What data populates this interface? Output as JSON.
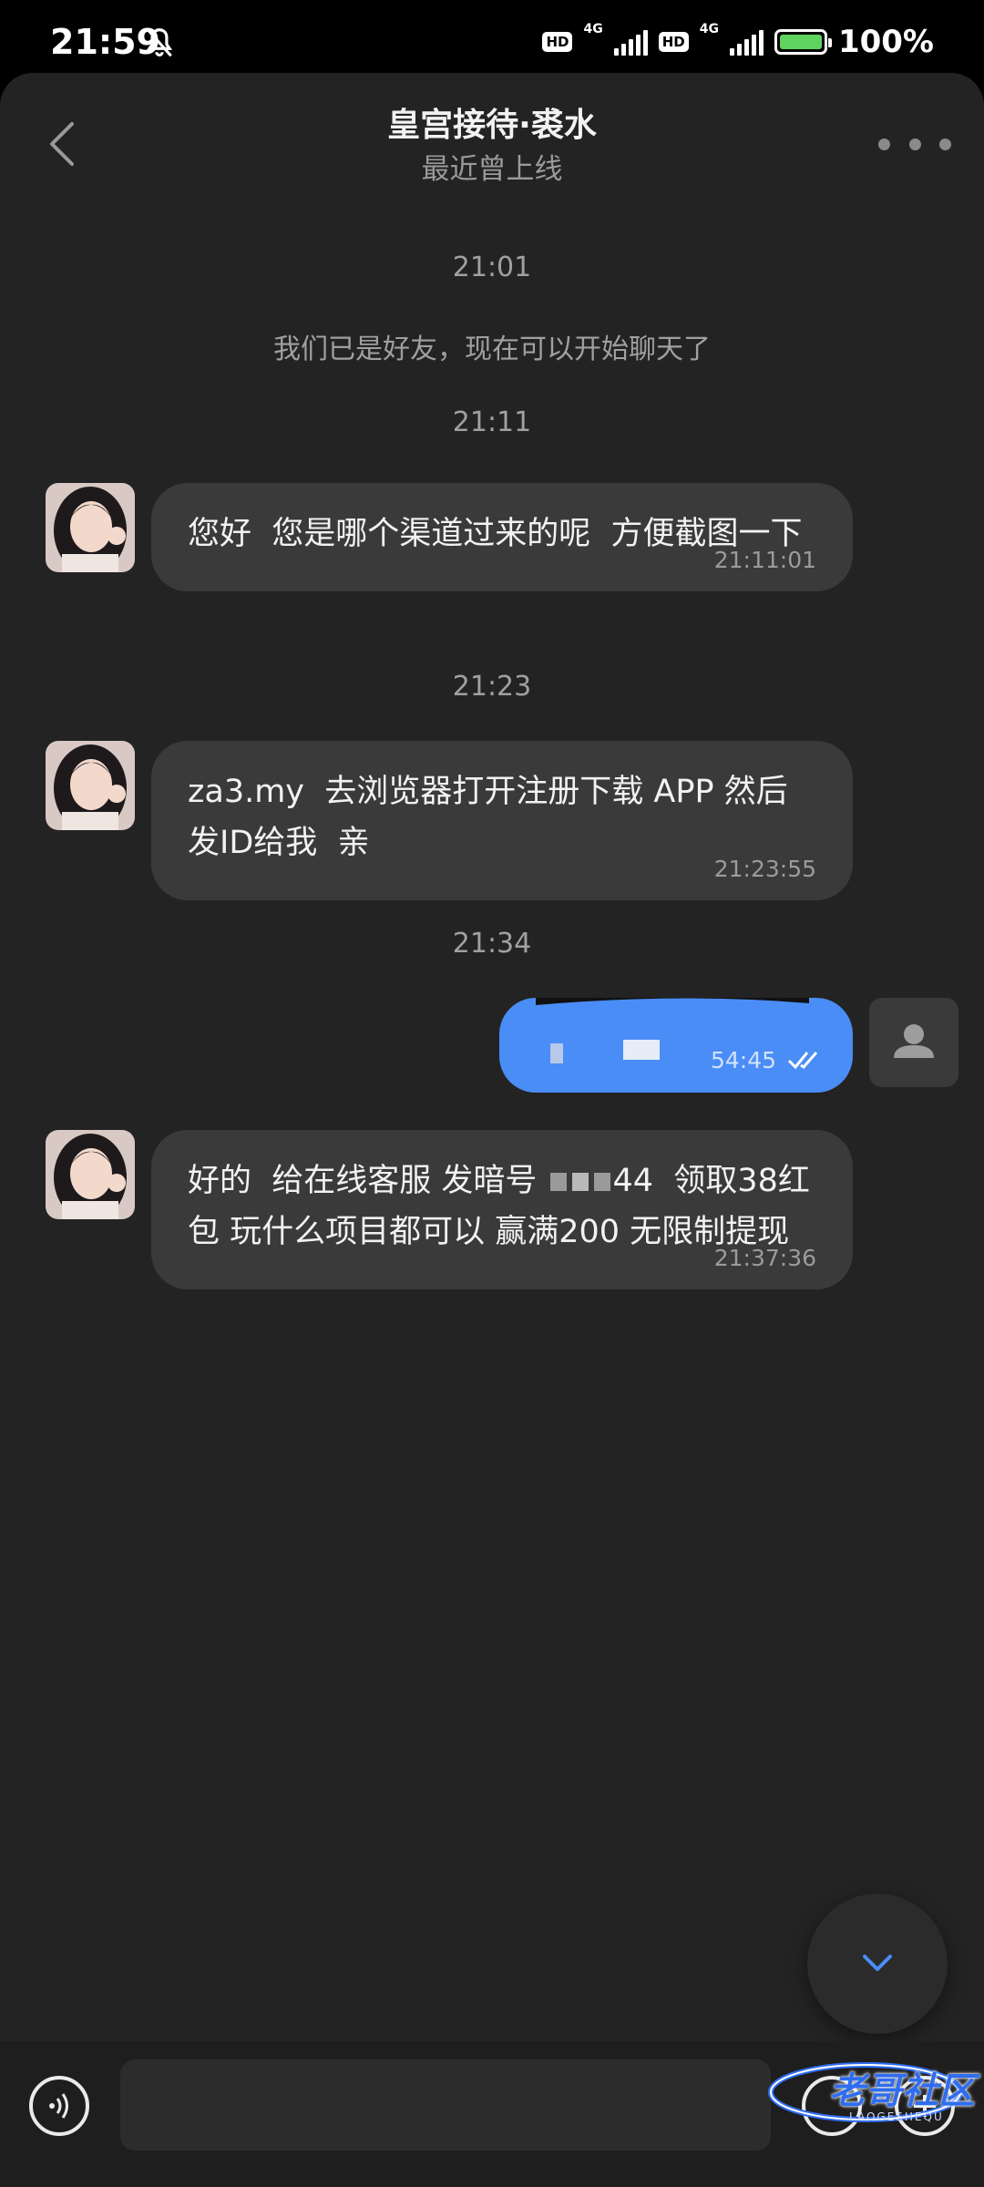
{
  "status_bar": {
    "time": "21:59",
    "hd_label": "HD",
    "network_label": "4G",
    "battery_percent": "100%",
    "battery_level": 1.0
  },
  "header": {
    "contact_name": "皇宫接待·裘水",
    "contact_status": "最近曾上线"
  },
  "chat": {
    "time_1": "21:01",
    "system_note": "我们已是好友，现在可以开始聊天了",
    "time_2": "21:11",
    "msg_1": {
      "text": "您好  您是哪个渠道过来的呢  方便截图一下",
      "time": "21:11:01"
    },
    "time_3": "21:23",
    "msg_2": {
      "text": "za3.my  去浏览器打开注册下载 APP 然后发ID给我  亲",
      "time": "21:23:55"
    },
    "time_4": "21:34",
    "msg_out": {
      "time_partial": "54:45"
    },
    "msg_3": {
      "text_before_mask": "好的  给在线客服 发暗号 ",
      "text_after_mask": "44  领取38红包 玩什么项目都可以 赢满200 无限制提现",
      "time": "21:37:36"
    }
  },
  "input": {
    "placeholder": ""
  },
  "watermark": {
    "text": "老哥社区",
    "sub": "LAOGESHEQU"
  },
  "colors": {
    "panel_bg": "#232323",
    "incoming_bubble": "#3a3a3a",
    "outgoing_bubble": "#4a8df6",
    "accent": "#4a8df6"
  }
}
